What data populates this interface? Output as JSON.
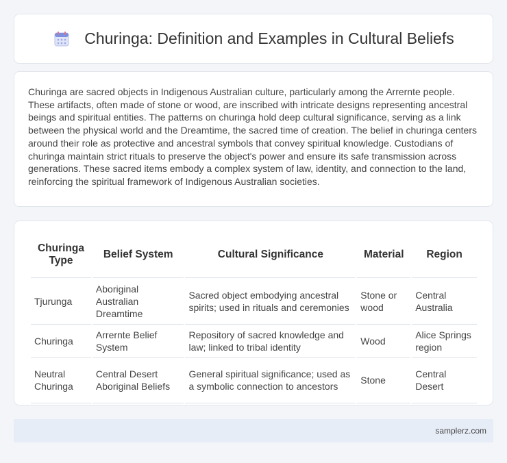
{
  "header": {
    "title": "Churinga: Definition and Examples in Cultural Beliefs",
    "icon": "calendar-icon"
  },
  "intro": {
    "text": "Churinga are sacred objects in Indigenous Australian culture, particularly among the Arrernte people. These artifacts, often made of stone or wood, are inscribed with intricate designs representing ancestral beings and spiritual entities. The patterns on churinga hold deep cultural significance, serving as a link between the physical world and the Dreamtime, the sacred time of creation. The belief in churinga centers around their role as protective and ancestral symbols that convey spiritual knowledge. Custodians of churinga maintain strict rituals to preserve the object's power and ensure its safe transmission across generations. These sacred items embody a complex system of law, identity, and connection to the land, reinforcing the spiritual framework of Indigenous Australian societies."
  },
  "table": {
    "headers": [
      "Churinga Type",
      "Belief System",
      "Cultural Significance",
      "Material",
      "Region"
    ],
    "rows": [
      [
        "Tjurunga",
        "Aboriginal Australian Dreamtime",
        "Sacred object embodying ancestral spirits; used in rituals and ceremonies",
        "Stone or wood",
        "Central Australia"
      ],
      [
        "Churinga",
        "Arrernte Belief System",
        "Repository of sacred knowledge and law; linked to tribal identity",
        "Wood",
        "Alice Springs region"
      ],
      [
        "Neutral Churinga",
        "Central Desert Aboriginal Beliefs",
        "General spiritual significance; used as a symbolic connection to ancestors",
        "Stone",
        "Central Desert"
      ]
    ]
  },
  "footer": {
    "site": "samplerz.com"
  }
}
